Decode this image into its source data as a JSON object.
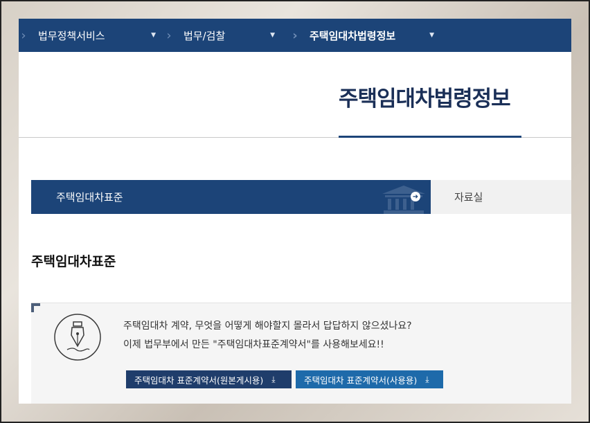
{
  "breadcrumb": {
    "items": [
      {
        "label": "법무정책서비스"
      },
      {
        "label": "법무/검찰"
      },
      {
        "label": "주택임대차법령정보"
      }
    ]
  },
  "page": {
    "title": "주택임대차법령정보"
  },
  "tabs": {
    "active_label": "주택임대차표준",
    "other_label": "자료실"
  },
  "section": {
    "heading": "주택임대차표준"
  },
  "info": {
    "line1": "주택임대차 계약, 무엇을 어떻게 해야할지 몰라서 답답하지 않으셨나요?",
    "line2": "이제 법무부에서 만든 \"주택임대차표준계약서\"를 사용해보세요!!",
    "button1_label": "주택임대차 표준계약서(원본게시용)",
    "button2_label": "주택임대차 표준계약서(사용용)"
  },
  "colors": {
    "brand_navy": "#1c4478",
    "button_navy": "#1f3d6b",
    "button_blue": "#1e6aaa"
  },
  "icons": {
    "breadcrumb_separator": "chevron-right-icon",
    "breadcrumb_dropdown": "caret-down-icon",
    "tab_arrow": "arrow-right-circle-icon",
    "tab_decoration": "building-icon",
    "info_icon": "fountain-pen-icon",
    "download": "download-icon"
  }
}
